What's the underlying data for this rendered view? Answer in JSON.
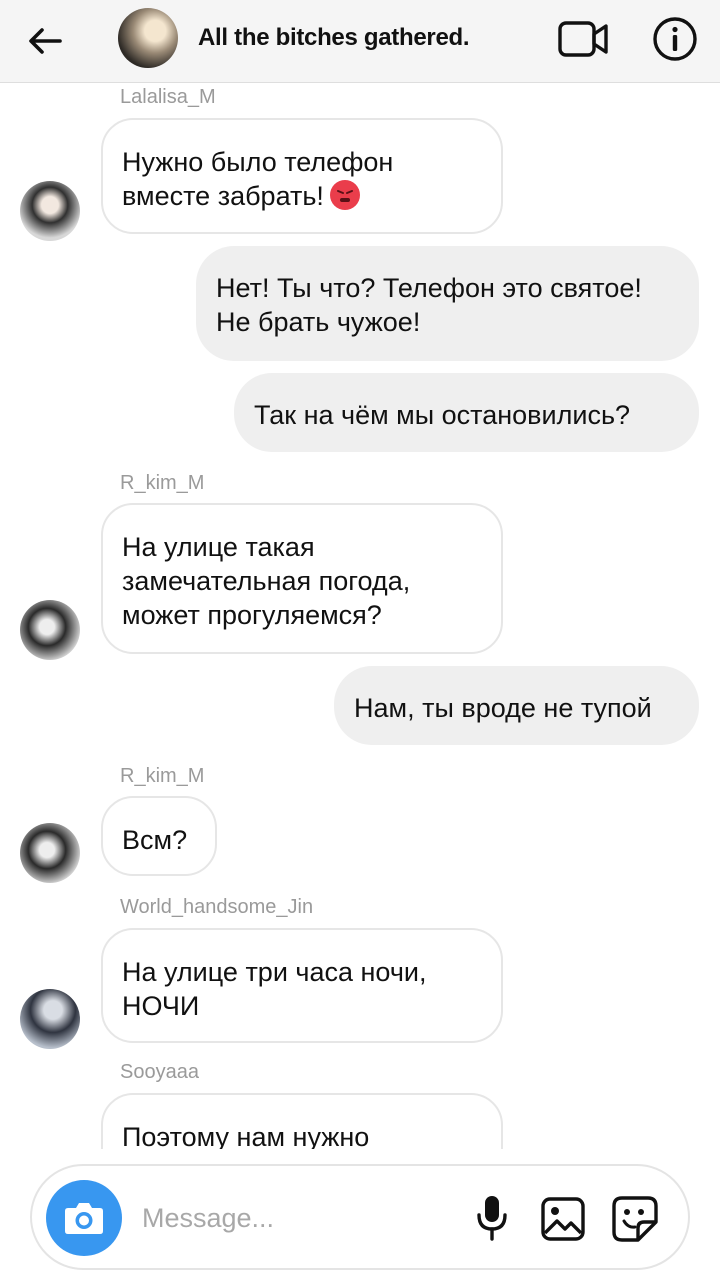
{
  "header": {
    "title": "All the bitches gathered.",
    "icons": [
      "arrow-left-icon",
      "video-camera-icon",
      "info-icon"
    ]
  },
  "messages": [
    {
      "type": "in",
      "sender": "Lalalisa_M",
      "text": "Нужно было телефон\nвместе забрать!",
      "emoji": "angry-face"
    },
    {
      "type": "out",
      "text": "Нет! Ты что? Телефон это святое!\nНе брать чужое!"
    },
    {
      "type": "out",
      "text": "Так на чём мы остановились?"
    },
    {
      "type": "in",
      "sender": "R_kim_M",
      "text": "На улице такая\nзамечательная погода,\nможет прогуляемся?"
    },
    {
      "type": "out",
      "text": "Нам, ты вроде не тупой"
    },
    {
      "type": "in",
      "sender": "R_kim_M",
      "text": "Всм?"
    },
    {
      "type": "in",
      "sender": "World_handsome_Jin",
      "text": "На улице три часа ночи,\nНОЧИ"
    },
    {
      "type": "in",
      "sender": "Sooyaaa",
      "text": "Поэтому нам нужно"
    }
  ],
  "composer": {
    "placeholder": "Message...",
    "icons": [
      "camera-icon",
      "microphone-icon",
      "gallery-icon",
      "sticker-icon"
    ]
  },
  "colors": {
    "accent": "#3897f0",
    "outgoing_bubble": "#efefef",
    "incoming_border": "#e6e6e6",
    "angry_emoji": "#ea3d4b"
  }
}
